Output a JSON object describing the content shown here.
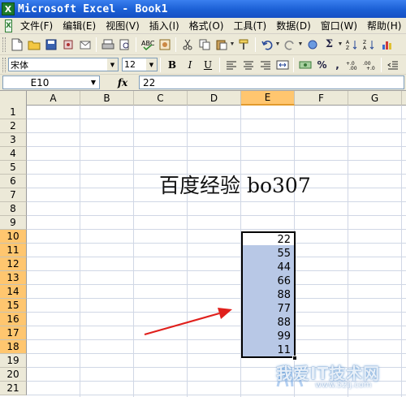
{
  "window": {
    "title": "Microsoft Excel - Book1",
    "app_icon": "excel-icon"
  },
  "menu": {
    "items": [
      {
        "label": "文件(F)"
      },
      {
        "label": "编辑(E)"
      },
      {
        "label": "视图(V)"
      },
      {
        "label": "插入(I)"
      },
      {
        "label": "格式(O)"
      },
      {
        "label": "工具(T)"
      },
      {
        "label": "数据(D)"
      },
      {
        "label": "窗口(W)"
      },
      {
        "label": "帮助(H)"
      }
    ]
  },
  "toolbar": {
    "font_name": "宋体",
    "font_size": "12",
    "bold_label": "B",
    "italic_label": "I",
    "underline_label": "U",
    "percent_label": "%",
    "comma_label": ",",
    "sigma_label": "Σ"
  },
  "formula_bar": {
    "name_box": "E10",
    "fx_label": "fx",
    "formula": "22"
  },
  "sheet": {
    "columns": [
      "A",
      "B",
      "C",
      "D",
      "E",
      "F",
      "G"
    ],
    "rows": [
      "1",
      "2",
      "3",
      "4",
      "5",
      "6",
      "7",
      "8",
      "9",
      "10",
      "11",
      "12",
      "13",
      "14",
      "15",
      "16",
      "17",
      "18",
      "19",
      "20",
      "21"
    ],
    "selected_column": "E",
    "selected_rows": [
      "10",
      "11",
      "12",
      "13",
      "14",
      "15",
      "16",
      "17",
      "18"
    ],
    "heading_text": "百度经验 bo307",
    "values": [
      "22",
      "55",
      "44",
      "66",
      "88",
      "77",
      "88",
      "99",
      "11"
    ]
  },
  "colors": {
    "title_blue": "#1b5fd4",
    "header_highlight": "#ffc66f",
    "selection": "#b8c8e6",
    "arrow_red": "#e0201c"
  },
  "watermark": {
    "text": "我爱IT技术网",
    "url": "www.52ij.com"
  }
}
